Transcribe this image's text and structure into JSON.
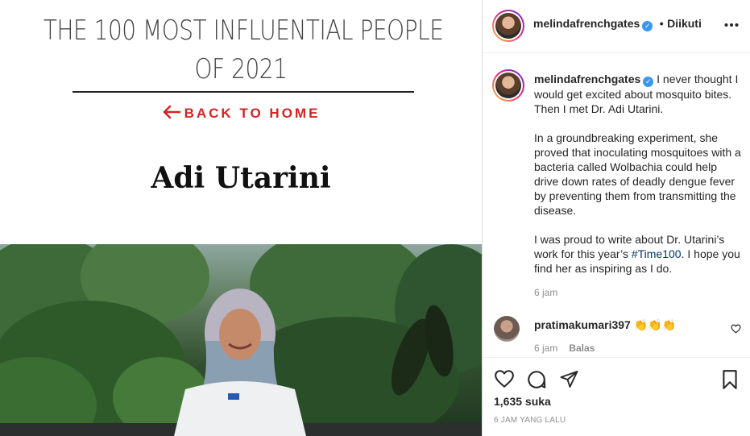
{
  "media": {
    "headline_line1": "THE 100 MOST INFLUENTIAL PEOPLE",
    "headline_line2": "OF 2021",
    "back_link": "BACK TO HOME",
    "person_name": "Adi Utarini",
    "accent_color": "#d42424"
  },
  "header": {
    "username": "melindafrenchgates",
    "separator": "•",
    "follow_status": "Diikuti",
    "more_icon": "more-horizontal-icon"
  },
  "caption": {
    "username": "melindafrenchgates",
    "intro": "I never thought I would get excited about mosquito bites. Then I met Dr. Adi Utarini.",
    "paragraph2": "In a groundbreaking experiment, she proved that inoculating mosquitoes with a bacteria called Wolbachia could help drive down rates of deadly dengue fever by preventing them from transmitting the disease.",
    "paragraph3_before": "I was proud to write about Dr. Utarini’s work for this year’s ",
    "hashtag": "#Time100",
    "paragraph3_after": ". I hope you find her as inspiring as I do.",
    "time": "6 jam"
  },
  "comment": {
    "username": "pratimakumari397",
    "emoji": "👏👏👏",
    "time": "6 jam",
    "reply_label": "Balas"
  },
  "actions": {
    "icons": [
      "heart-icon",
      "comment-icon",
      "share-icon",
      "bookmark-icon"
    ],
    "likes": "1,635 suka",
    "date": "6 JAM YANG LALU"
  },
  "colors": {
    "verified": "#3897f0",
    "hashtag": "#00376b",
    "muted": "#8e8e8e"
  }
}
